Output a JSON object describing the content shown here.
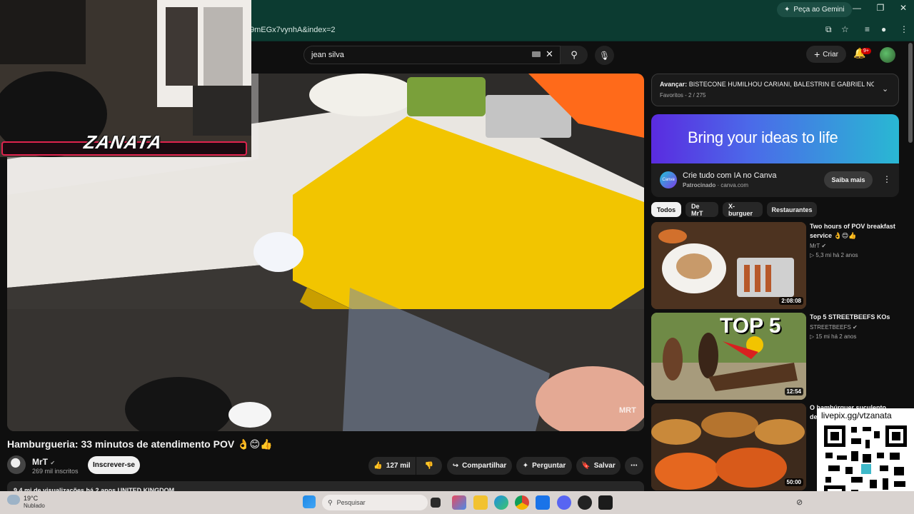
{
  "browser": {
    "url_fragment": "9mEGx7vynhA&index=2",
    "gemini_label": "Peça ao Gemini"
  },
  "youtube": {
    "search_value": "jean silva",
    "create_label": "Criar",
    "notif_badge": "9+"
  },
  "video": {
    "overlay_text": "ZANATA",
    "watermark": "MRT",
    "title": "Hamburgueria: 33 minutos de atendimento POV 👌😊👍",
    "channel": "MrT",
    "subs": "269 mil inscritos",
    "subscribe_label": "Inscrever-se",
    "likes": "127 mil",
    "share_label": "Compartilhar",
    "ask_label": "Perguntar",
    "save_label": "Salvar",
    "meta_line": "9,4 mi de visualizações  há 2 anos  UNITED KINGDOM"
  },
  "playlist": {
    "next_prefix": "Avançar:",
    "next_title": "BISTECONE HUMILHOU CARIANI, BALESTRIN E GABRIEL NO...",
    "sub": "Favoritos - 2 / 275"
  },
  "ad": {
    "banner_text": "Bring your ideas to life",
    "logo": "Canva",
    "title": "Crie tudo com IA no Canva",
    "sponsored": "Patrocinado",
    "domain": "canva.com",
    "cta": "Saiba mais"
  },
  "chips": [
    "Todos",
    "De MrT",
    "X-burguer",
    "Restaurantes"
  ],
  "recommended": [
    {
      "title": "Two hours of POV breakfast service 👌😊👍",
      "channel": "MrT",
      "meta": "5,3 mi  há 2 anos",
      "duration": "2:08:08"
    },
    {
      "title": "Top 5 STREETBEEFS KOs",
      "channel": "STREETBEEFS",
      "meta": "15 mi  há 2 anos",
      "duration": "12:54",
      "thumb_text": "TOP 5"
    },
    {
      "title": "O hambúrguer suculento de...",
      "channel": "",
      "meta": "",
      "duration": "50:00"
    }
  ],
  "qr": {
    "label": "livepix.gg/vtzanata"
  },
  "taskbar": {
    "temp": "19°C",
    "weather": "Nublado",
    "search_placeholder": "Pesquisar"
  }
}
